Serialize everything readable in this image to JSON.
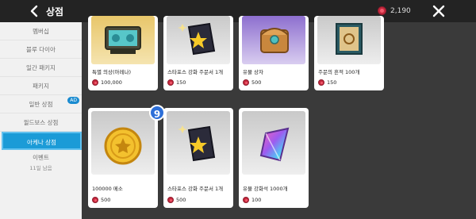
{
  "header": {
    "title": "상점",
    "currency_value": "2,190",
    "accent": "#1b9bd7"
  },
  "sidebar": {
    "items": [
      {
        "label": "멤버십"
      },
      {
        "label": "블루 다이아"
      },
      {
        "label": "일간 패키지"
      },
      {
        "label": "패키지"
      },
      {
        "label": "일반 상점",
        "badge": "AD"
      },
      {
        "label": "윌드보스 상점"
      },
      {
        "label": "아케나 상점",
        "active": true
      }
    ],
    "event": {
      "label": "이벤트",
      "sub": "11일 남음"
    }
  },
  "cards": [
    {
      "name": "특별 의상(아레나)",
      "price": "100,000",
      "icon": "special-outfit-icon"
    },
    {
      "name": "스타포스 강화 주문서 1개",
      "price": "150",
      "icon": "starforce-scroll-icon"
    },
    {
      "name": "유물 상자",
      "price": "500",
      "icon": "relic-chest-icon"
    },
    {
      "name": "주문의 흔적 100개",
      "price": "150",
      "icon": "spell-trace-icon"
    },
    {
      "name": "100000 메소",
      "price": "500",
      "icon": "meso-coin-icon"
    },
    {
      "name": "스타포스 강화 주문서 1개",
      "price": "500",
      "icon": "starforce-scroll-icon"
    },
    {
      "name": "유물 강화석 1000개",
      "price": "100",
      "icon": "relic-crystal-icon"
    }
  ],
  "floating_badge": "9"
}
